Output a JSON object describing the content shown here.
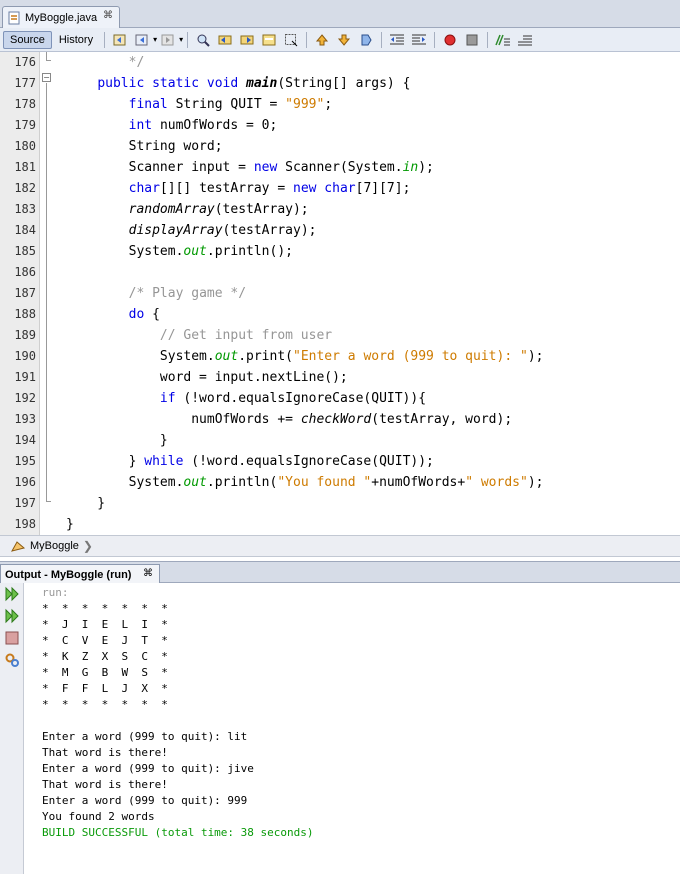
{
  "editor_tab": {
    "filename": "MyBoggle.java",
    "close": "⌘"
  },
  "toolbar": {
    "source_label": "Source",
    "history_label": "History"
  },
  "code": {
    "lines": [
      {
        "n": "176",
        "segs": [
          {
            "t": "        "
          },
          {
            "t": "*/",
            "c": "cm"
          }
        ]
      },
      {
        "n": "177",
        "segs": [
          {
            "t": "    "
          },
          {
            "t": "public static void ",
            "c": "kw"
          },
          {
            "t": "main",
            "c": "bi"
          },
          {
            "t": "(String[] args) {"
          }
        ]
      },
      {
        "n": "178",
        "segs": [
          {
            "t": "        "
          },
          {
            "t": "final ",
            "c": "kw"
          },
          {
            "t": "String QUIT = "
          },
          {
            "t": "\"999\"",
            "c": "str"
          },
          {
            "t": ";"
          }
        ]
      },
      {
        "n": "179",
        "segs": [
          {
            "t": "        "
          },
          {
            "t": "int ",
            "c": "kw"
          },
          {
            "t": "numOfWords = 0;"
          }
        ]
      },
      {
        "n": "180",
        "segs": [
          {
            "t": "        String word;"
          }
        ]
      },
      {
        "n": "181",
        "segs": [
          {
            "t": "        Scanner input = "
          },
          {
            "t": "new ",
            "c": "kw"
          },
          {
            "t": "Scanner(System."
          },
          {
            "t": "in",
            "c": "fld"
          },
          {
            "t": ");"
          }
        ]
      },
      {
        "n": "182",
        "segs": [
          {
            "t": "        "
          },
          {
            "t": "char",
            "c": "kw"
          },
          {
            "t": "[][] testArray = "
          },
          {
            "t": "new char",
            "c": "kw"
          },
          {
            "t": "[7][7];"
          }
        ]
      },
      {
        "n": "183",
        "segs": [
          {
            "t": "        "
          },
          {
            "t": "randomArray",
            "c": "mi"
          },
          {
            "t": "(testArray);"
          }
        ]
      },
      {
        "n": "184",
        "segs": [
          {
            "t": "        "
          },
          {
            "t": "displayArray",
            "c": "mi"
          },
          {
            "t": "(testArray);"
          }
        ]
      },
      {
        "n": "185",
        "segs": [
          {
            "t": "        System."
          },
          {
            "t": "out",
            "c": "fld"
          },
          {
            "t": ".println();"
          }
        ]
      },
      {
        "n": "186",
        "segs": [
          {
            "t": ""
          }
        ]
      },
      {
        "n": "187",
        "segs": [
          {
            "t": "        "
          },
          {
            "t": "/* Play game */",
            "c": "cm"
          }
        ]
      },
      {
        "n": "188",
        "segs": [
          {
            "t": "        "
          },
          {
            "t": "do",
            "c": "kw"
          },
          {
            "t": " {"
          }
        ]
      },
      {
        "n": "189",
        "segs": [
          {
            "t": "            "
          },
          {
            "t": "// Get input from user",
            "c": "cm"
          }
        ]
      },
      {
        "n": "190",
        "segs": [
          {
            "t": "            System."
          },
          {
            "t": "out",
            "c": "fld"
          },
          {
            "t": ".print("
          },
          {
            "t": "\"Enter a word (999 to quit): \"",
            "c": "str"
          },
          {
            "t": ");"
          }
        ]
      },
      {
        "n": "191",
        "segs": [
          {
            "t": "            word = input.nextLine();"
          }
        ]
      },
      {
        "n": "192",
        "segs": [
          {
            "t": "            "
          },
          {
            "t": "if",
            "c": "kw"
          },
          {
            "t": " (!word.equalsIgnoreCase(QUIT)){"
          }
        ]
      },
      {
        "n": "193",
        "segs": [
          {
            "t": "                numOfWords += "
          },
          {
            "t": "checkWord",
            "c": "mi"
          },
          {
            "t": "(testArray, word);"
          }
        ]
      },
      {
        "n": "194",
        "segs": [
          {
            "t": "            }"
          }
        ]
      },
      {
        "n": "195",
        "segs": [
          {
            "t": "        } "
          },
          {
            "t": "while",
            "c": "kw"
          },
          {
            "t": " (!word.equalsIgnoreCase(QUIT));"
          }
        ]
      },
      {
        "n": "196",
        "segs": [
          {
            "t": "        System."
          },
          {
            "t": "out",
            "c": "fld"
          },
          {
            "t": ".println("
          },
          {
            "t": "\"You found \"",
            "c": "str"
          },
          {
            "t": "+numOfWords+"
          },
          {
            "t": "\" words\"",
            "c": "str"
          },
          {
            "t": ");"
          }
        ]
      },
      {
        "n": "197",
        "segs": [
          {
            "t": "    }"
          }
        ]
      },
      {
        "n": "198",
        "segs": [
          {
            "t": "}"
          }
        ]
      }
    ]
  },
  "breadcrumb": {
    "label": "MyBoggle"
  },
  "output": {
    "tab_title": "Output - MyBoggle (run)",
    "close": "⌘",
    "lines": [
      {
        "t": "run:",
        "c": "run"
      },
      {
        "t": "*  *  *  *  *  *  *"
      },
      {
        "t": "*  J  I  E  L  I  *"
      },
      {
        "t": "*  C  V  E  J  T  *"
      },
      {
        "t": "*  K  Z  X  S  C  *"
      },
      {
        "t": "*  M  G  B  W  S  *"
      },
      {
        "t": "*  F  F  L  J  X  *"
      },
      {
        "t": "*  *  *  *  *  *  *"
      },
      {
        "t": ""
      },
      {
        "t": "Enter a word (999 to quit): lit"
      },
      {
        "t": "That word is there!"
      },
      {
        "t": "Enter a word (999 to quit): jive"
      },
      {
        "t": "That word is there!"
      },
      {
        "t": "Enter a word (999 to quit): 999"
      },
      {
        "t": "You found 2 words"
      },
      {
        "t": "BUILD SUCCESSFUL (total time: 38 seconds)",
        "c": "ok"
      }
    ]
  }
}
